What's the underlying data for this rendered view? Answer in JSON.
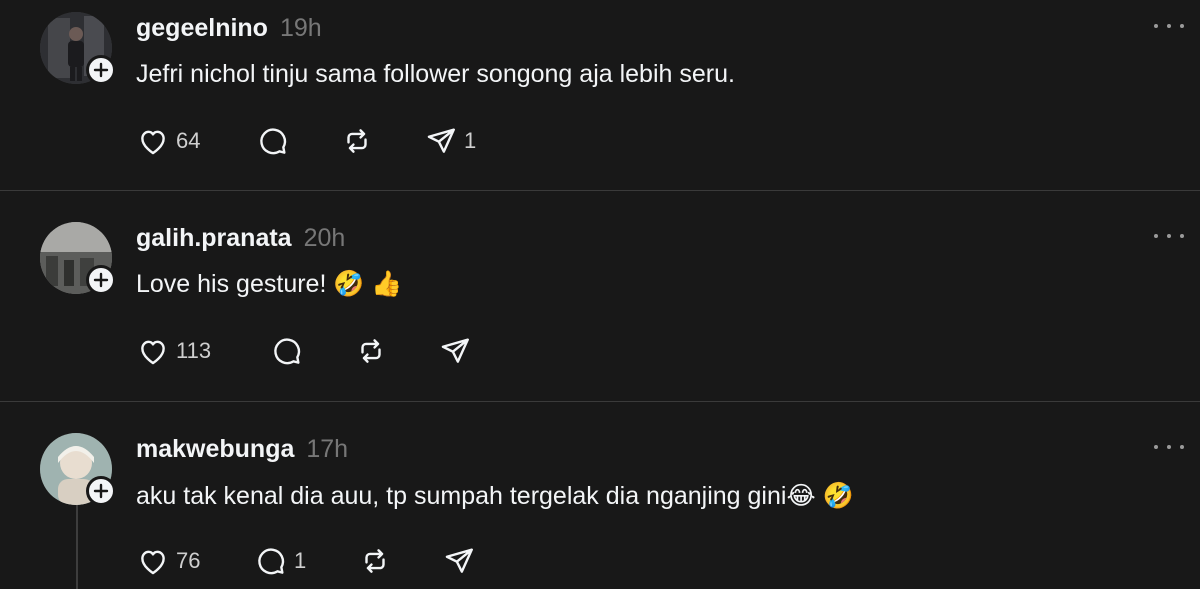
{
  "posts": [
    {
      "username": "gegeelnino",
      "time": "19h",
      "text": "Jefri nichol tinju sama follower songong aja lebih seru.",
      "likes": "64",
      "replies": "",
      "reposts": "",
      "shares": "1"
    },
    {
      "username": "galih.pranata",
      "time": "20h",
      "text": "Love his gesture! 🤣 👍",
      "likes": "113",
      "replies": "",
      "reposts": "",
      "shares": ""
    },
    {
      "username": "makwebunga",
      "time": "17h",
      "text": "aku tak kenal dia auu, tp sumpah tergelak dia nganjing gini😂 🤣",
      "likes": "76",
      "replies": "1",
      "reposts": "",
      "shares": ""
    }
  ],
  "icons": {
    "like": "heart-icon",
    "reply": "comment-icon",
    "repost": "repost-icon",
    "share": "send-icon",
    "more": "more-icon",
    "follow": "plus-icon"
  },
  "colors": {
    "background": "#181818",
    "text": "#f3f5f7",
    "muted": "#777777",
    "divider": "#3a3a3a"
  }
}
